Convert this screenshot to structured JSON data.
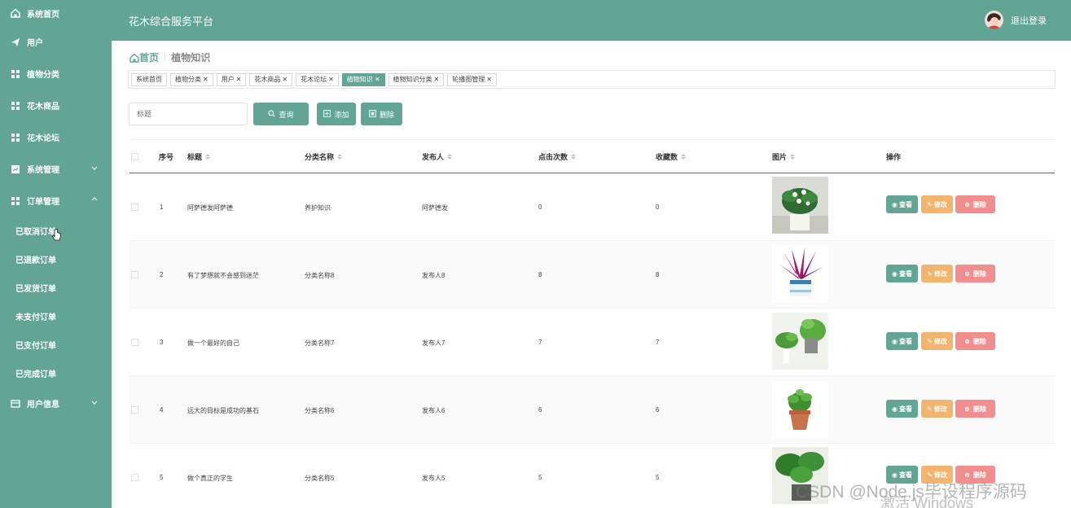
{
  "app": {
    "title": "花木综合服务平台",
    "logout": "退出登录"
  },
  "sidebar": {
    "items": [
      {
        "label": "系统首页",
        "icon": "home-icon"
      },
      {
        "label": "用户",
        "icon": "send-icon"
      },
      {
        "label": "植物分类",
        "icon": "grid-icon"
      },
      {
        "label": "花木商品",
        "icon": "grid-icon"
      },
      {
        "label": "花木论坛",
        "icon": "grid-icon"
      },
      {
        "label": "系统管理",
        "icon": "chart-icon",
        "expandable": true
      },
      {
        "label": "订单管理",
        "icon": "grid-icon",
        "expanded": true
      }
    ],
    "sub_items": [
      "已取消订单",
      "已退款订单",
      "已发货订单",
      "未支付订单",
      "已支付订单",
      "已完成订单"
    ],
    "user_info": "用户信息"
  },
  "breadcrumb": {
    "home": "首页",
    "current": "植物知识"
  },
  "tags": [
    {
      "label": "系统首页",
      "closable": false,
      "active": false
    },
    {
      "label": "植物分类",
      "closable": true,
      "active": false
    },
    {
      "label": "用户",
      "closable": true,
      "active": false
    },
    {
      "label": "花木商品",
      "closable": true,
      "active": false
    },
    {
      "label": "花木论坛",
      "closable": true,
      "active": false
    },
    {
      "label": "植物知识",
      "closable": true,
      "active": true
    },
    {
      "label": "植物知识分类",
      "closable": true,
      "active": false
    },
    {
      "label": "轮播图管理",
      "closable": true,
      "active": false
    }
  ],
  "search": {
    "placeholder": "标题",
    "query_label": "查询",
    "add_label": "添加",
    "delete_label": "删除"
  },
  "table": {
    "columns": [
      "序号",
      "标题",
      "分类名称",
      "发布人",
      "点击次数",
      "收藏数",
      "图片",
      "操作"
    ],
    "rows": [
      {
        "index": "1",
        "title": "阿萨德发阿萨德",
        "category": "养护知识",
        "publisher": "阿萨德发",
        "clicks": "0",
        "favorites": "0"
      },
      {
        "index": "2",
        "title": "有了梦想就不会感到迷茫",
        "category": "分类名称8",
        "publisher": "发布人8",
        "clicks": "8",
        "favorites": "8"
      },
      {
        "index": "3",
        "title": "做一个最好的自己",
        "category": "分类名称7",
        "publisher": "发布人7",
        "clicks": "7",
        "favorites": "7"
      },
      {
        "index": "4",
        "title": "远大的目标是成功的基石",
        "category": "分类名称6",
        "publisher": "发布人6",
        "clicks": "6",
        "favorites": "6"
      },
      {
        "index": "5",
        "title": "做个真正的学生",
        "category": "分类名称5",
        "publisher": "发布人5",
        "clicks": "5",
        "favorites": "5"
      }
    ],
    "actions": {
      "view": "查看",
      "edit": "修改",
      "delete": "删除"
    }
  },
  "watermark": {
    "line1": "CSDN @Node.js毕设程序源码",
    "line2": "激活 Windows"
  },
  "colors": {
    "primary": "#62a594",
    "edit": "#f3b46e",
    "delete": "#f38e8e"
  }
}
